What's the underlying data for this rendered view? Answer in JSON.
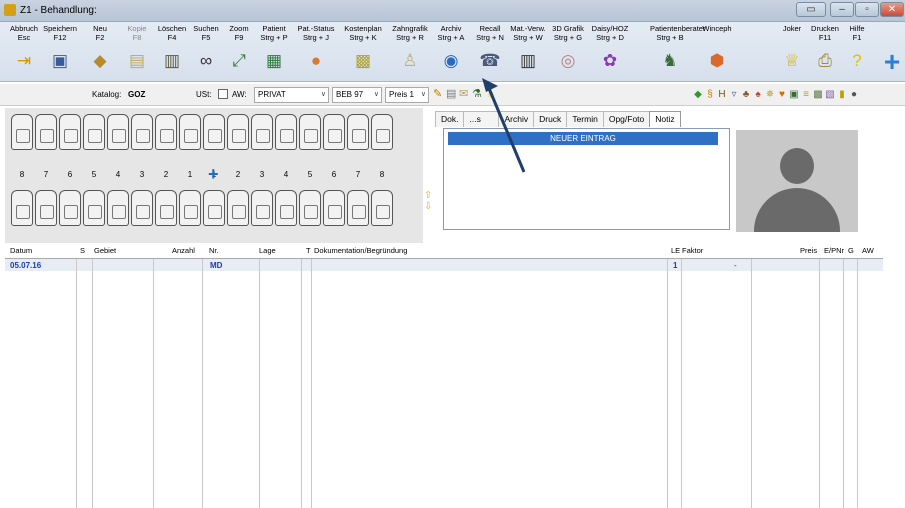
{
  "window": {
    "title": "Z1 - Behandlung:"
  },
  "toolbar": {
    "buttons": [
      {
        "label": "Abbruch",
        "key": "Esc",
        "icon": "exit-icon"
      },
      {
        "label": "Speichern",
        "key": "F12",
        "icon": "save-icon"
      },
      {
        "label": "Neu",
        "key": "F2",
        "icon": "new-icon"
      },
      {
        "label": "Kopie",
        "key": "F8",
        "icon": "copy-icon"
      },
      {
        "label": "Löschen",
        "key": "F4",
        "icon": "trash-icon"
      },
      {
        "label": "Suchen",
        "key": "F5",
        "icon": "binoculars-icon"
      },
      {
        "label": "Zoom",
        "key": "F9",
        "icon": "zoom-icon"
      },
      {
        "label": "Patient",
        "key": "Strg + P",
        "icon": "patient-card-icon"
      },
      {
        "label": "Pat.-Status",
        "key": "Strg + J",
        "icon": "patient-status-icon"
      },
      {
        "label": "Kostenplan",
        "key": "Strg + K",
        "icon": "plan-icon"
      },
      {
        "label": "Zahngrafik",
        "key": "Strg + R",
        "icon": "tooth-icon"
      },
      {
        "label": "Archiv",
        "key": "Strg + A",
        "icon": "archive-icon"
      },
      {
        "label": "Recall",
        "key": "Strg + N",
        "icon": "recall-icon"
      },
      {
        "label": "Mat.-Verw.",
        "key": "Strg + W",
        "icon": "material-icon"
      },
      {
        "label": "3D Grafik",
        "key": "Strg + G",
        "icon": "3d-icon"
      },
      {
        "label": "Daisy/HOZ",
        "key": "Strg + D",
        "icon": "daisy-icon"
      },
      {
        "label": "Patientenberater",
        "key": "Strg + B",
        "icon": "advisor-icon"
      },
      {
        "label": "Winceph",
        "key": "",
        "icon": "winceph-icon"
      },
      {
        "label": "Joker",
        "key": "",
        "icon": "crown-icon"
      },
      {
        "label": "Drucken",
        "key": "F11",
        "icon": "print-icon"
      },
      {
        "label": "Hilfe",
        "key": "F1",
        "icon": "help-icon"
      }
    ]
  },
  "filter": {
    "katalog_label": "Katalog:",
    "katalog_value": "GOZ",
    "ust_label": "USt:",
    "aw_label": "AW:",
    "select1": "PRIVAT",
    "select2": "BEB 97",
    "select3": "Preis 1"
  },
  "teeth": {
    "numbers": [
      "8",
      "7",
      "6",
      "5",
      "4",
      "3",
      "2",
      "1",
      "1",
      "2",
      "3",
      "4",
      "5",
      "6",
      "7",
      "8"
    ]
  },
  "tabs": [
    "Dok.",
    "...s",
    "Archiv",
    "Druck",
    "Termin",
    "Opg/Foto",
    "Notiz"
  ],
  "notiz": {
    "entry": "NEUER EINTRAG"
  },
  "grid": {
    "headers": [
      "Datum",
      "S",
      "Gebiet",
      "Anzahl",
      "Nr.",
      "Lage",
      "T",
      "Dokumentation/Begründung",
      "LE",
      "Faktor",
      "Preis",
      "E/PNr",
      "G",
      "AW"
    ],
    "row": {
      "datum": "05.07.16",
      "nr": "MD",
      "le": "1",
      "faktor_mark": "-"
    }
  }
}
